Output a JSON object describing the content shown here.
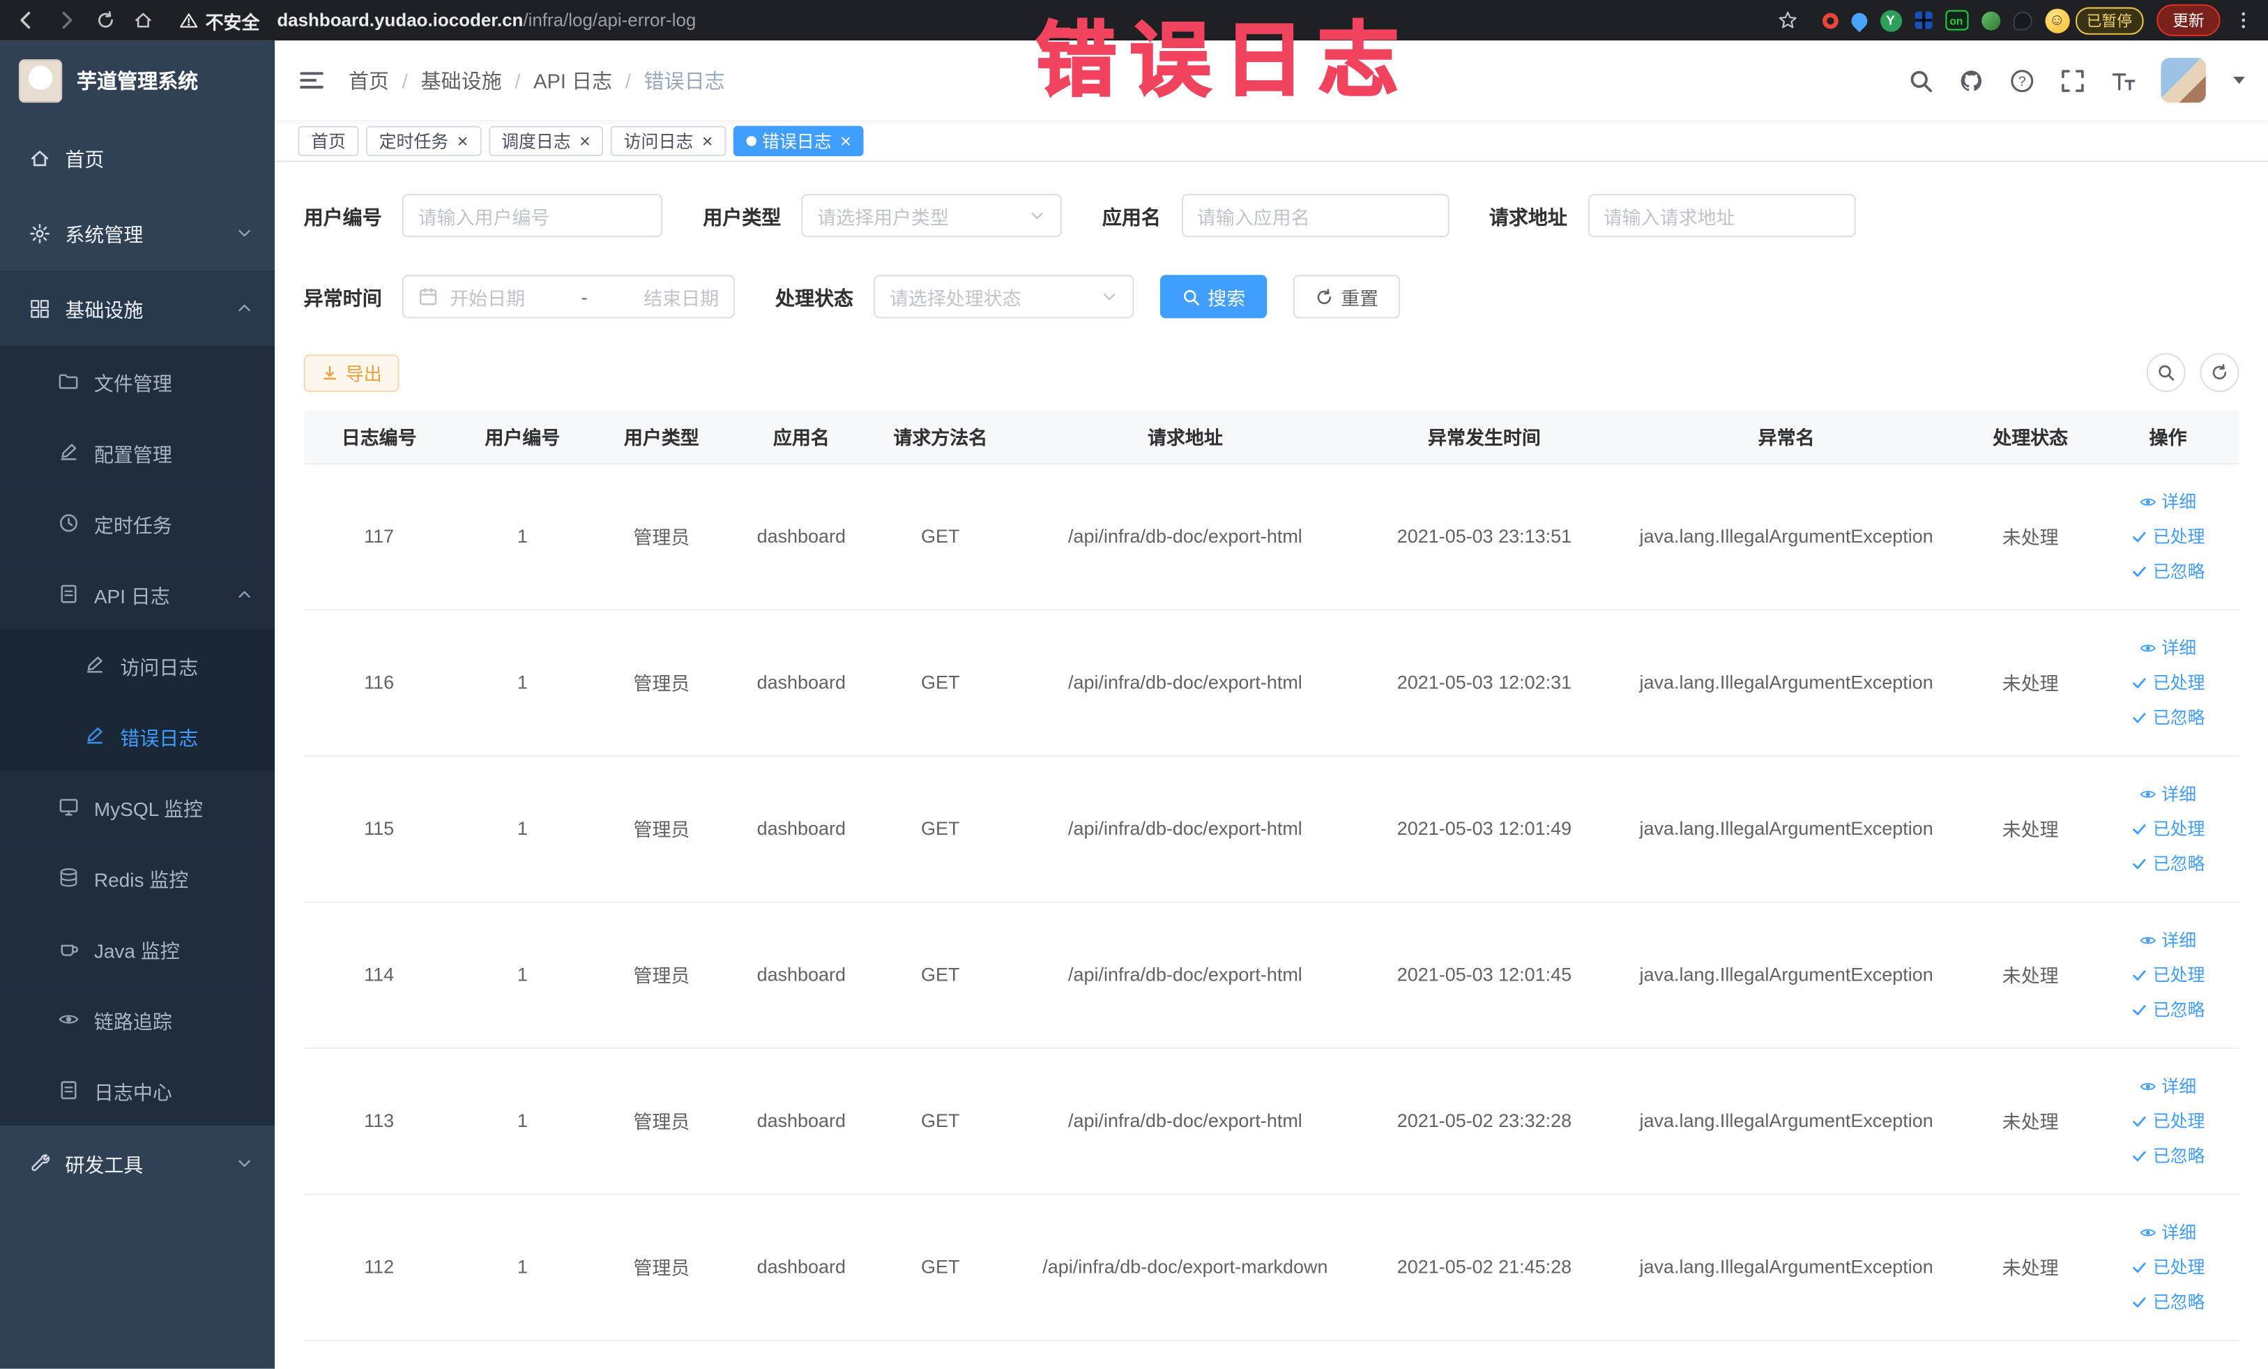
{
  "annotation": {
    "label": "错误日志"
  },
  "colors": {
    "primary": "#409eff",
    "annotation_red": "#f1425e",
    "warning": "#e6a23c",
    "sidebar_bg": "#304156"
  },
  "browser": {
    "security_label": "不安全",
    "url_domain": "dashboard.yudao.iocoder.cn",
    "url_path": "/infra/log/api-error-log",
    "extensions": {
      "y_label": "Y",
      "on_label": "on"
    },
    "profile_paused_label": "已暂停",
    "update_button_label": "更新"
  },
  "sidebar": {
    "logo_title": "芋道管理系统",
    "items": [
      {
        "key": "home",
        "label": "首页",
        "level": 0,
        "icon": "home"
      },
      {
        "key": "system",
        "label": "系统管理",
        "level": 0,
        "icon": "gear",
        "chevron": "down"
      },
      {
        "key": "infra",
        "label": "基础设施",
        "level": 0,
        "icon": "grid",
        "chevron": "up",
        "open": true
      },
      {
        "key": "file",
        "label": "文件管理",
        "level": 1,
        "icon": "folder"
      },
      {
        "key": "config",
        "label": "配置管理",
        "level": 1,
        "icon": "edit"
      },
      {
        "key": "job",
        "label": "定时任务",
        "level": 1,
        "icon": "clock"
      },
      {
        "key": "api-log",
        "label": "API 日志",
        "level": 1,
        "icon": "doc",
        "chevron": "up"
      },
      {
        "key": "access-log",
        "label": "访问日志",
        "level": 2,
        "icon": "edit"
      },
      {
        "key": "error-log",
        "label": "错误日志",
        "level": 2,
        "icon": "edit",
        "active": true
      },
      {
        "key": "mysql",
        "label": "MySQL 监控",
        "level": 1,
        "icon": "monitor"
      },
      {
        "key": "redis",
        "label": "Redis 监控",
        "level": 1,
        "icon": "db"
      },
      {
        "key": "java",
        "label": "Java 监控",
        "level": 1,
        "icon": "coffee"
      },
      {
        "key": "trace",
        "label": "链路追踪",
        "level": 1,
        "icon": "eye"
      },
      {
        "key": "log-center",
        "label": "日志中心",
        "level": 1,
        "icon": "doc"
      },
      {
        "key": "dev-tools",
        "label": "研发工具",
        "level": 0,
        "icon": "tool",
        "chevron": "down"
      }
    ]
  },
  "header": {
    "breadcrumb": [
      "首页",
      "基础设施",
      "API 日志",
      "错误日志"
    ]
  },
  "tabs": [
    {
      "label": "首页",
      "closable": false,
      "active": false
    },
    {
      "label": "定时任务",
      "closable": true,
      "active": false
    },
    {
      "label": "调度日志",
      "closable": true,
      "active": false
    },
    {
      "label": "访问日志",
      "closable": true,
      "active": false
    },
    {
      "label": "错误日志",
      "closable": true,
      "active": true
    }
  ],
  "filters": {
    "user_id_label": "用户编号",
    "user_id_placeholder": "请输入用户编号",
    "user_type_label": "用户类型",
    "user_type_placeholder": "请选择用户类型",
    "app_name_label": "应用名",
    "app_name_placeholder": "请输入应用名",
    "request_url_label": "请求地址",
    "request_url_placeholder": "请输入请求地址",
    "exception_time_label": "异常时间",
    "date_start_placeholder": "开始日期",
    "date_separator": "-",
    "date_end_placeholder": "结束日期",
    "process_status_label": "处理状态",
    "process_status_placeholder": "请选择处理状态",
    "search_label": "搜索",
    "reset_label": "重置"
  },
  "toolbar": {
    "export_label": "导出"
  },
  "table": {
    "columns": [
      "日志编号",
      "用户编号",
      "用户类型",
      "应用名",
      "请求方法名",
      "请求地址",
      "异常发生时间",
      "异常名",
      "处理状态",
      "操作"
    ],
    "action_labels": {
      "detail": "详细",
      "processed": "已处理",
      "ignored": "已忽略"
    },
    "rows": [
      {
        "log_id": "117",
        "user_id": "1",
        "user_type": "管理员",
        "app_name": "dashboard",
        "method": "GET",
        "url": "/api/infra/db-doc/export-html",
        "time": "2021-05-03 23:13:51",
        "exception": "java.lang.IllegalArgumentException",
        "status": "未处理"
      },
      {
        "log_id": "116",
        "user_id": "1",
        "user_type": "管理员",
        "app_name": "dashboard",
        "method": "GET",
        "url": "/api/infra/db-doc/export-html",
        "time": "2021-05-03 12:02:31",
        "exception": "java.lang.IllegalArgumentException",
        "status": "未处理"
      },
      {
        "log_id": "115",
        "user_id": "1",
        "user_type": "管理员",
        "app_name": "dashboard",
        "method": "GET",
        "url": "/api/infra/db-doc/export-html",
        "time": "2021-05-03 12:01:49",
        "exception": "java.lang.IllegalArgumentException",
        "status": "未处理"
      },
      {
        "log_id": "114",
        "user_id": "1",
        "user_type": "管理员",
        "app_name": "dashboard",
        "method": "GET",
        "url": "/api/infra/db-doc/export-html",
        "time": "2021-05-03 12:01:45",
        "exception": "java.lang.IllegalArgumentException",
        "status": "未处理"
      },
      {
        "log_id": "113",
        "user_id": "1",
        "user_type": "管理员",
        "app_name": "dashboard",
        "method": "GET",
        "url": "/api/infra/db-doc/export-html",
        "time": "2021-05-02 23:32:28",
        "exception": "java.lang.IllegalArgumentException",
        "status": "未处理"
      },
      {
        "log_id": "112",
        "user_id": "1",
        "user_type": "管理员",
        "app_name": "dashboard",
        "method": "GET",
        "url": "/api/infra/db-doc/export-markdown",
        "time": "2021-05-02 21:45:28",
        "exception": "java.lang.IllegalArgumentException",
        "status": "未处理"
      }
    ]
  }
}
